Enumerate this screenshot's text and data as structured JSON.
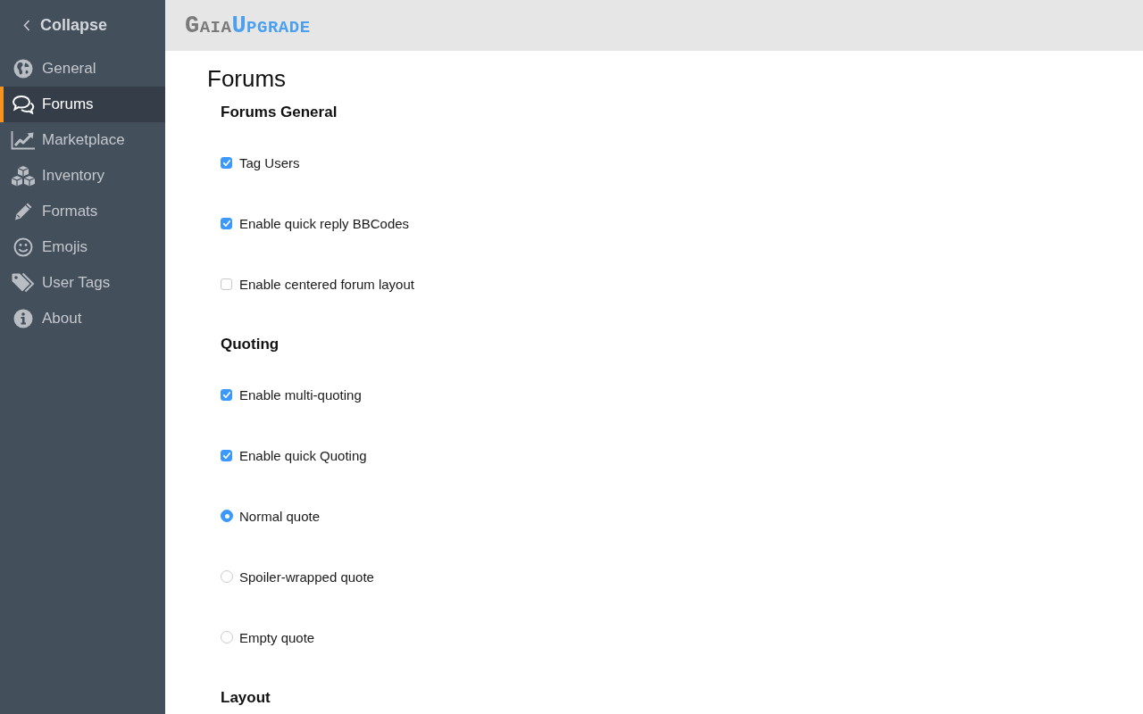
{
  "sidebar": {
    "collapse": {
      "label": "Collapse"
    },
    "items": [
      {
        "label": "General",
        "selected": false
      },
      {
        "label": "Forums",
        "selected": true
      },
      {
        "label": "Marketplace",
        "selected": false
      },
      {
        "label": "Inventory",
        "selected": false
      },
      {
        "label": "Formats",
        "selected": false
      },
      {
        "label": "Emojis",
        "selected": false
      },
      {
        "label": "User Tags",
        "selected": false
      },
      {
        "label": "About",
        "selected": false
      }
    ]
  },
  "header": {
    "logo": [
      "Gaia",
      "Upgrade"
    ]
  },
  "page": {
    "title": "Forums",
    "sections": [
      {
        "heading": "Forums General",
        "options": [
          {
            "kind": "checkbox",
            "label": "Tag Users",
            "checked": true
          },
          {
            "kind": "checkbox",
            "label": "Enable quick reply BBCodes",
            "checked": true
          },
          {
            "kind": "checkbox",
            "label": "Enable centered forum layout",
            "checked": false
          }
        ]
      },
      {
        "heading": "Quoting",
        "options": [
          {
            "kind": "checkbox",
            "label": "Enable multi-quoting",
            "checked": true
          },
          {
            "kind": "checkbox",
            "label": "Enable quick Quoting",
            "checked": true
          },
          {
            "kind": "radio",
            "label": "Normal quote",
            "selected": true
          },
          {
            "kind": "radio",
            "label": "Spoiler-wrapped quote",
            "selected": false
          },
          {
            "kind": "radio",
            "label": "Empty quote",
            "selected": false
          }
        ]
      },
      {
        "heading": "Layout"
      }
    ]
  }
}
